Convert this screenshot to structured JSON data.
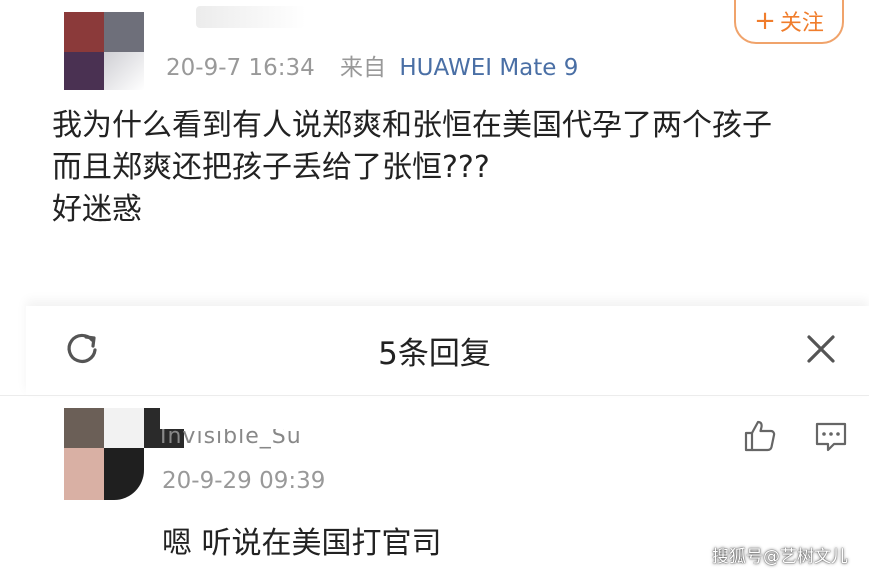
{
  "post": {
    "follow_label": "关注",
    "follow_plus": "+",
    "timestamp": "20-9-7 16:34",
    "source_prefix": "来自",
    "device": "HUAWEI Mate 9",
    "body_lines": [
      "我为什么看到有人说郑爽和张恒在美国代孕了两个孩子",
      "而且郑爽还把孩子丢给了张恒???",
      "好迷惑"
    ]
  },
  "reply_panel": {
    "title": "5条回复",
    "refresh_icon": "refresh-icon",
    "close_icon": "close-icon"
  },
  "reply": {
    "username": "Invisible_Su",
    "timestamp": "20-9-29 09:39",
    "text": "嗯 听说在美国打官司",
    "like_icon": "thumbs-up-icon",
    "comment_icon": "comment-icon"
  },
  "watermark": "搜狐号@艺树文儿",
  "colors": {
    "accent_orange": "#f07d2c",
    "device_blue": "#4a6fa5",
    "meta_gray": "#999999"
  }
}
